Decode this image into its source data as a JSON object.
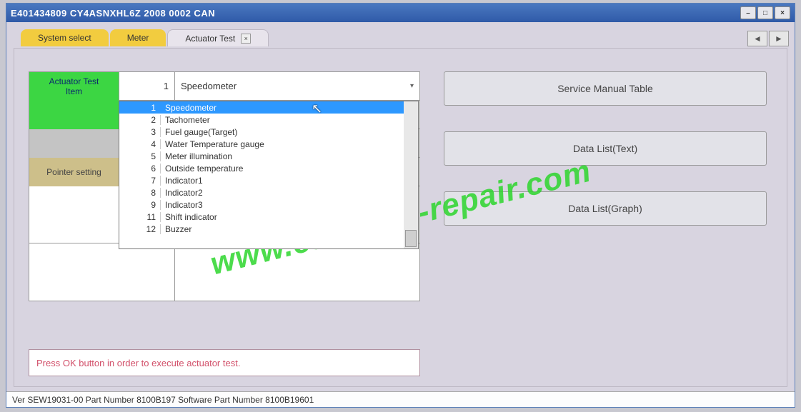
{
  "titlebar": {
    "title": "E401434809  CY4ASNXHL6Z 2008   0002 CAN"
  },
  "tabs": {
    "system_select": "System select",
    "meter": "Meter",
    "actuator_test": "Actuator Test"
  },
  "grid": {
    "actuator_test_item_label": "Actuator Test\nItem",
    "actuator_test_item_num": "1",
    "actuator_test_item_value": "Speedometer",
    "pointer_setting_label": "Pointer setting"
  },
  "dropdown": {
    "options": [
      {
        "n": "1",
        "label": "Speedometer",
        "selected": true
      },
      {
        "n": "2",
        "label": "Tachometer"
      },
      {
        "n": "3",
        "label": "Fuel gauge(Target)"
      },
      {
        "n": "4",
        "label": "Water Temperature gauge"
      },
      {
        "n": "5",
        "label": "Meter illumination"
      },
      {
        "n": "6",
        "label": "Outside temperature"
      },
      {
        "n": "7",
        "label": "Indicator1"
      },
      {
        "n": "8",
        "label": "Indicator2"
      },
      {
        "n": "9",
        "label": "Indicator3"
      },
      {
        "n": "11",
        "label": "Shift indicator"
      },
      {
        "n": "12",
        "label": "Buzzer"
      }
    ]
  },
  "right_buttons": {
    "service_manual": "Service Manual Table",
    "data_list_text": "Data List(Text)",
    "data_list_graph": "Data List(Graph)"
  },
  "instruction": "Press OK button in order to execute actuator test.",
  "statusbar": "Ver SEW19031-00 Part Number 8100B197   Software Part Number 8100B19601",
  "watermark": "www.car-auto-repair.com"
}
